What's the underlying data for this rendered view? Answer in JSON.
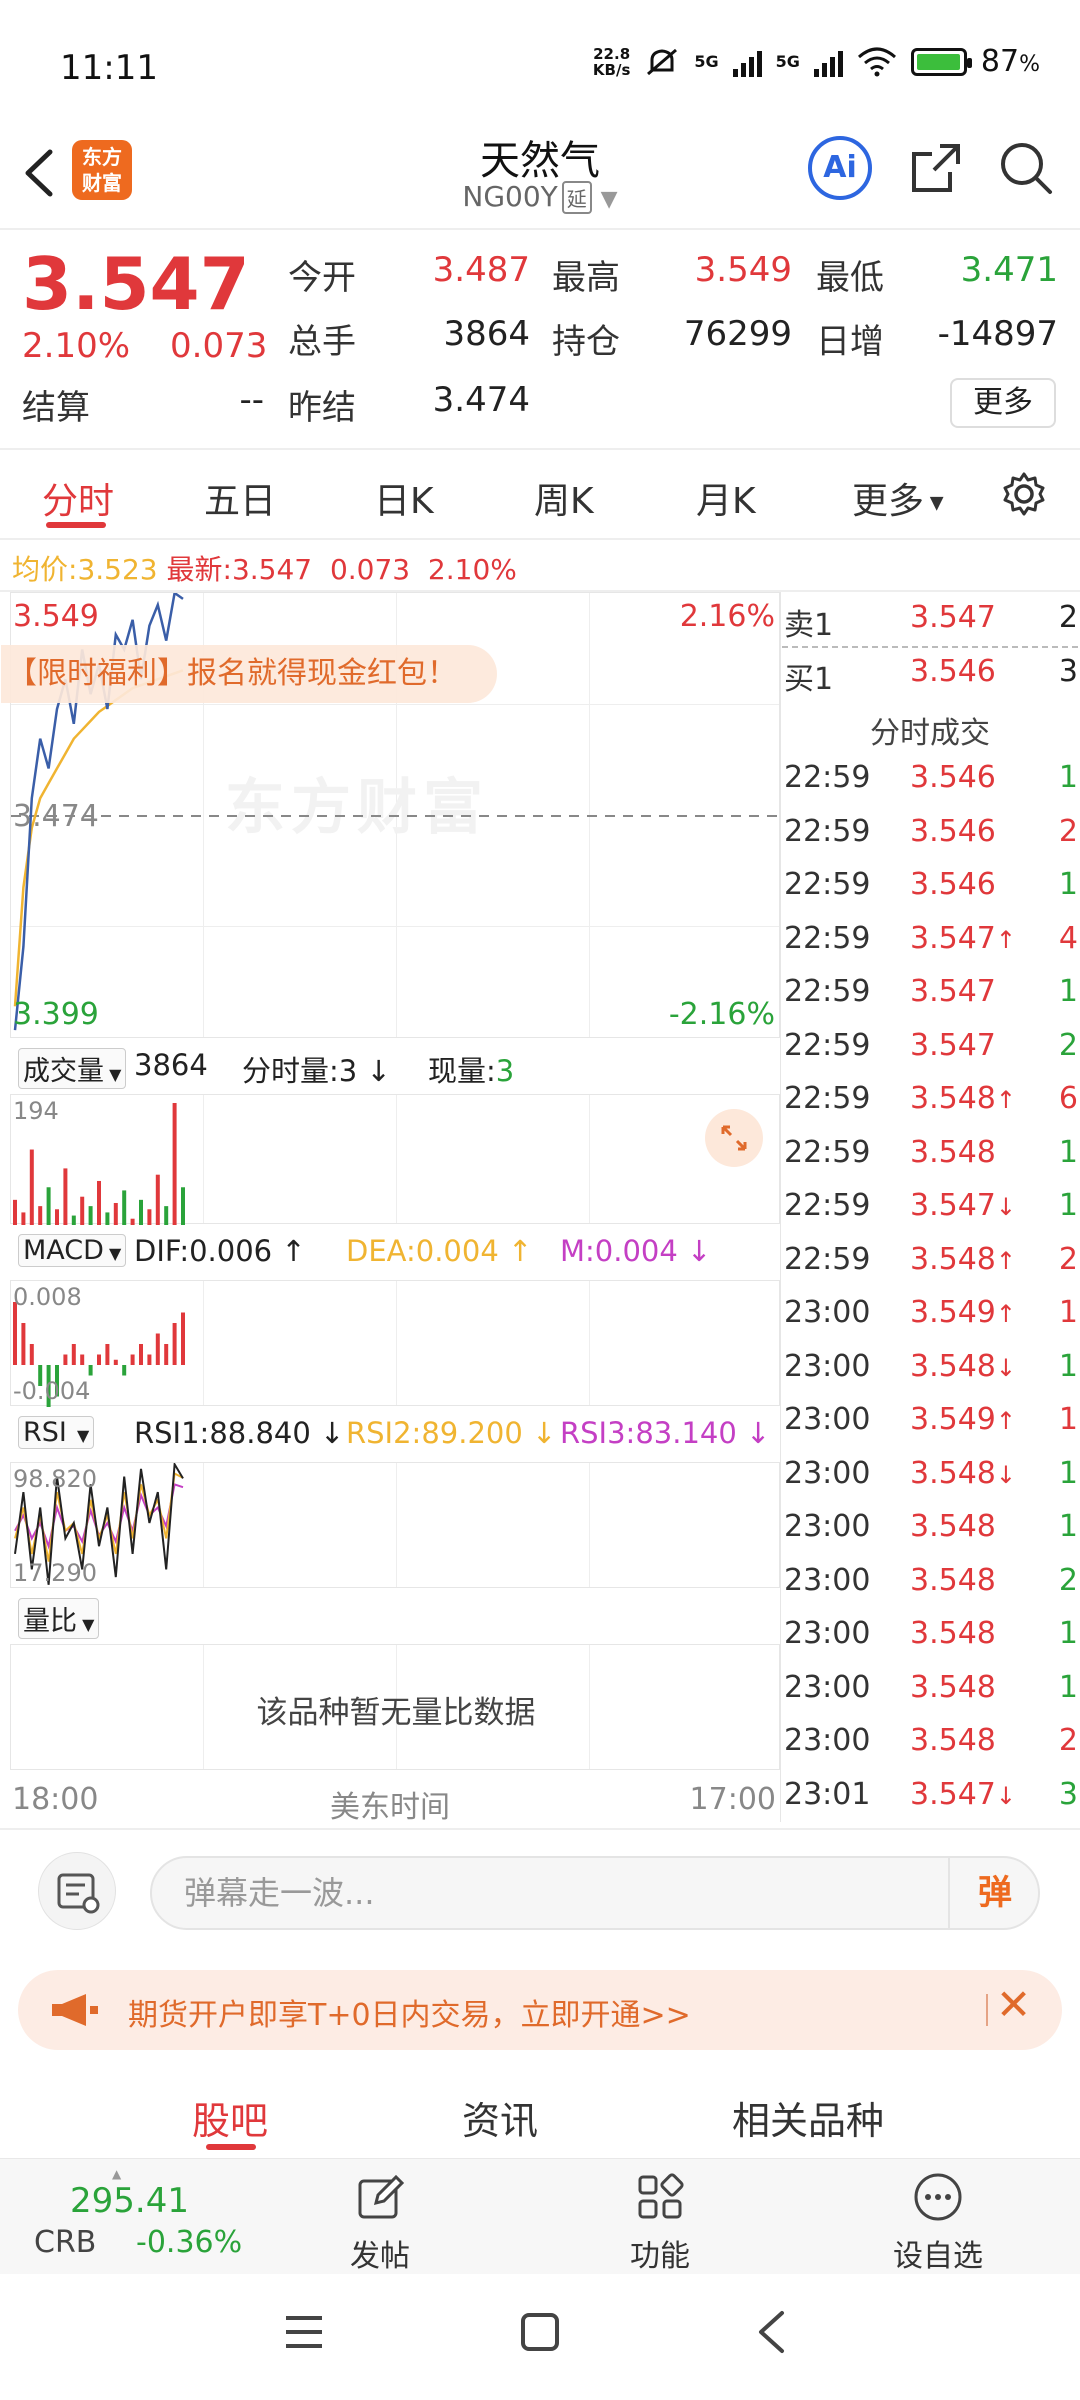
{
  "status": {
    "time": "11:11",
    "net_speed_top": "22.8",
    "net_speed_unit": "KB/s",
    "sim1": "5G",
    "sim2": "5G",
    "battery": "87",
    "battery_unit": "%",
    "battery_level": 0.87
  },
  "header": {
    "back_icon": "chevron-left-icon",
    "logo_line1": "东方",
    "logo_line2": "财富",
    "title": "天然气",
    "code": "NG00Y",
    "delay_tag": "延",
    "ai_label": "Ai"
  },
  "quote": {
    "price": "3.547",
    "change_pct": "2.10%",
    "change": "0.073",
    "open_label": "今开",
    "open": "3.487",
    "high_label": "最高",
    "high": "3.549",
    "low_label": "最低",
    "low": "3.471",
    "volume_label": "总手",
    "volume": "3864",
    "oi_label": "持仓",
    "oi": "76299",
    "daily_inc_label": "日增",
    "daily_inc": "-14897",
    "settle_label": "结算",
    "settle": "--",
    "prev_settle_label": "昨结",
    "prev_settle": "3.474",
    "more_label": "更多"
  },
  "tabs": [
    "分时",
    "五日",
    "日K",
    "周K",
    "月K",
    "更多"
  ],
  "avg_line": {
    "avg_label": "均价:",
    "avg": "3.523",
    "latest_label": "最新:",
    "latest": "3.547",
    "chg": "0.073",
    "pct": "2.10%"
  },
  "chart": {
    "top_left": "3.549",
    "top_right": "2.16%",
    "mid": "3.474",
    "bottom_left": "3.399",
    "bottom_right": "-2.16%",
    "watermark": "东方财富",
    "banner": "【限时福利】报名就得现金红包！",
    "vol_selector": "成交量",
    "vol_total": "3864",
    "vol_min_label": "分时量:3",
    "vol_now_label": "现量:",
    "vol_now": "3",
    "vol_max": "194",
    "macd_selector": "MACD",
    "dif": "DIF:0.006",
    "dea": "DEA:0.004",
    "m": "M:0.004",
    "macd_top": "0.008",
    "macd_bottom": "-0.004",
    "rsi_selector": "RSI",
    "rsi1": "RSI1:88.840",
    "rsi2": "RSI2:89.200",
    "rsi3": "RSI3:83.140",
    "rsi_top": "98.820",
    "rsi_bottom": "17.290",
    "lb_selector": "量比",
    "lb_empty": "该品种暂无量比数据",
    "x_start": "18:00",
    "x_mid": "美东时间",
    "x_end": "17:00"
  },
  "chart_data": {
    "type": "line",
    "ylim": [
      3.399,
      3.549
    ],
    "y_ref": 3.474,
    "price": [
      3.402,
      3.43,
      3.48,
      3.5,
      3.49,
      3.51,
      3.52,
      3.505,
      3.53,
      3.515,
      3.525,
      3.51,
      3.535,
      3.53,
      3.54,
      3.52,
      3.538,
      3.545,
      3.533,
      3.549,
      3.547
    ],
    "avg": [
      3.41,
      3.45,
      3.47,
      3.48,
      3.485,
      3.49,
      3.495,
      3.5,
      3.503,
      3.506,
      3.509,
      3.511,
      3.513,
      3.515,
      3.517,
      3.518,
      3.519,
      3.52,
      3.521,
      3.522,
      3.523
    ],
    "volume": [
      40,
      20,
      120,
      30,
      60,
      25,
      90,
      15,
      45,
      30,
      70,
      20,
      35,
      55,
      10,
      40,
      25,
      80,
      30,
      194,
      60
    ],
    "macd_hist": [
      0.006,
      0.004,
      0.002,
      -0.002,
      -0.004,
      -0.003,
      0.001,
      0.002,
      0.001,
      -0.001,
      0.001,
      0.002,
      0.0005,
      -0.001,
      0.001,
      0.002,
      0.001,
      0.003,
      0.002,
      0.004,
      0.005
    ],
    "rsi1": [
      40,
      80,
      30,
      70,
      20,
      90,
      50,
      60,
      30,
      85,
      45,
      70,
      25,
      90,
      40,
      95,
      60,
      80,
      30,
      98,
      88.84
    ],
    "rsi2": [
      50,
      70,
      40,
      65,
      35,
      80,
      55,
      60,
      40,
      75,
      50,
      65,
      40,
      80,
      50,
      85,
      65,
      75,
      50,
      92,
      89.2
    ],
    "rsi3": [
      55,
      65,
      50,
      60,
      45,
      70,
      55,
      58,
      48,
      68,
      52,
      60,
      48,
      70,
      55,
      78,
      65,
      70,
      58,
      85,
      83.14
    ]
  },
  "orderbook": {
    "sell_label": "卖1",
    "sell_price": "3.547",
    "sell_vol": "2",
    "buy_label": "买1",
    "buy_price": "3.546",
    "buy_vol": "3",
    "trades_title": "分时成交"
  },
  "trades": [
    {
      "t": "22:59",
      "p": "3.546",
      "v": "1",
      "dir": "",
      "pc": "red",
      "vc": "green"
    },
    {
      "t": "22:59",
      "p": "3.546",
      "v": "2",
      "dir": "",
      "pc": "red",
      "vc": "red"
    },
    {
      "t": "22:59",
      "p": "3.546",
      "v": "1",
      "dir": "",
      "pc": "red",
      "vc": "green"
    },
    {
      "t": "22:59",
      "p": "3.547",
      "v": "4",
      "dir": "↑",
      "pc": "red",
      "vc": "red"
    },
    {
      "t": "22:59",
      "p": "3.547",
      "v": "1",
      "dir": "",
      "pc": "red",
      "vc": "green"
    },
    {
      "t": "22:59",
      "p": "3.547",
      "v": "2",
      "dir": "",
      "pc": "red",
      "vc": "green"
    },
    {
      "t": "22:59",
      "p": "3.548",
      "v": "6",
      "dir": "↑",
      "pc": "red",
      "vc": "red"
    },
    {
      "t": "22:59",
      "p": "3.548",
      "v": "1",
      "dir": "",
      "pc": "red",
      "vc": "green"
    },
    {
      "t": "22:59",
      "p": "3.547",
      "v": "1",
      "dir": "↓",
      "pc": "red",
      "vc": "green"
    },
    {
      "t": "22:59",
      "p": "3.548",
      "v": "2",
      "dir": "↑",
      "pc": "red",
      "vc": "red"
    },
    {
      "t": "23:00",
      "p": "3.549",
      "v": "1",
      "dir": "↑",
      "pc": "red",
      "vc": "red"
    },
    {
      "t": "23:00",
      "p": "3.548",
      "v": "1",
      "dir": "↓",
      "pc": "red",
      "vc": "green"
    },
    {
      "t": "23:00",
      "p": "3.549",
      "v": "1",
      "dir": "↑",
      "pc": "red",
      "vc": "red"
    },
    {
      "t": "23:00",
      "p": "3.548",
      "v": "1",
      "dir": "↓",
      "pc": "red",
      "vc": "green"
    },
    {
      "t": "23:00",
      "p": "3.548",
      "v": "1",
      "dir": "",
      "pc": "red",
      "vc": "green"
    },
    {
      "t": "23:00",
      "p": "3.548",
      "v": "2",
      "dir": "",
      "pc": "red",
      "vc": "green"
    },
    {
      "t": "23:00",
      "p": "3.548",
      "v": "1",
      "dir": "",
      "pc": "red",
      "vc": "green"
    },
    {
      "t": "23:00",
      "p": "3.548",
      "v": "1",
      "dir": "",
      "pc": "red",
      "vc": "green"
    },
    {
      "t": "23:00",
      "p": "3.548",
      "v": "2",
      "dir": "",
      "pc": "red",
      "vc": "red"
    },
    {
      "t": "23:01",
      "p": "3.547",
      "v": "3",
      "dir": "↓",
      "pc": "red",
      "vc": "green"
    }
  ],
  "comment": {
    "placeholder": "弹幕走一波...",
    "dan_label": "弹"
  },
  "promo": {
    "text": "期货开户即享T+0日内交易，立即开通>>"
  },
  "bottom_tabs": [
    "股吧",
    "资讯",
    "相关品种"
  ],
  "toolbar": {
    "index_value": "295.41",
    "index_name": "CRB",
    "index_change": "-0.36%",
    "post_label": "发帖",
    "func_label": "功能",
    "watch_label": "设自选"
  },
  "colors": {
    "up": "#e0383b",
    "down": "#2aa33a",
    "accent": "#ee6a1f",
    "price_line": "#3a5ea8",
    "avg_line": "#f0b431",
    "rsi2": "#f0b431",
    "rsi3": "#c43fc4"
  }
}
